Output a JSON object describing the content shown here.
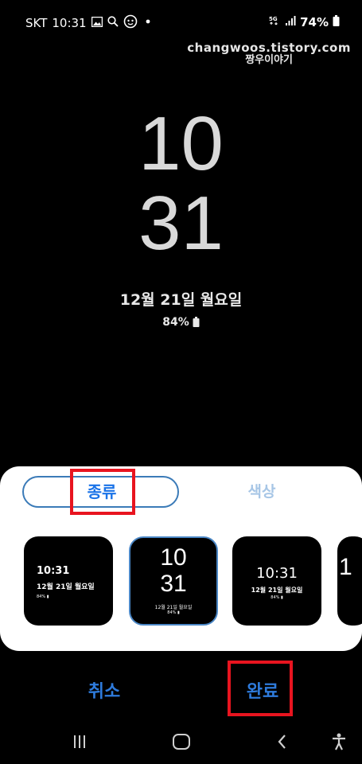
{
  "status_bar": {
    "carrier": "SKT",
    "time": "10:31",
    "network_badge": "5G",
    "battery": "74%",
    "icons": [
      "gallery-icon",
      "search-icon",
      "face-app-icon",
      "dot-icon",
      "signal-icon",
      "battery-icon"
    ]
  },
  "watermark": {
    "site": "changwoos.tistory.com",
    "name": "짱우이야기"
  },
  "lockscreen": {
    "hour": "10",
    "minute": "31",
    "date": "12월 21일 월요일",
    "battery": "84%"
  },
  "panel": {
    "tabs": [
      {
        "label": "종류",
        "selected": true
      },
      {
        "label": "색상",
        "selected": false
      }
    ],
    "styles": [
      {
        "time": "10:31",
        "date": "12월 21일 월요일",
        "battery": "84% ▮",
        "selected": false
      },
      {
        "hour": "10",
        "minute": "31",
        "date": "12월 21일 월요일",
        "battery": "84% ▮",
        "selected": true
      },
      {
        "time": "10:31",
        "date": "12월 21일 월요일",
        "battery": "84% ▮",
        "selected": false
      },
      {
        "hour": "1",
        "selected": false
      }
    ]
  },
  "actions": {
    "cancel": "취소",
    "done": "완료"
  },
  "colors": {
    "accent": "#2e7bdc",
    "highlight_box": "#e8141f",
    "tab_border": "#3b7bb8"
  }
}
